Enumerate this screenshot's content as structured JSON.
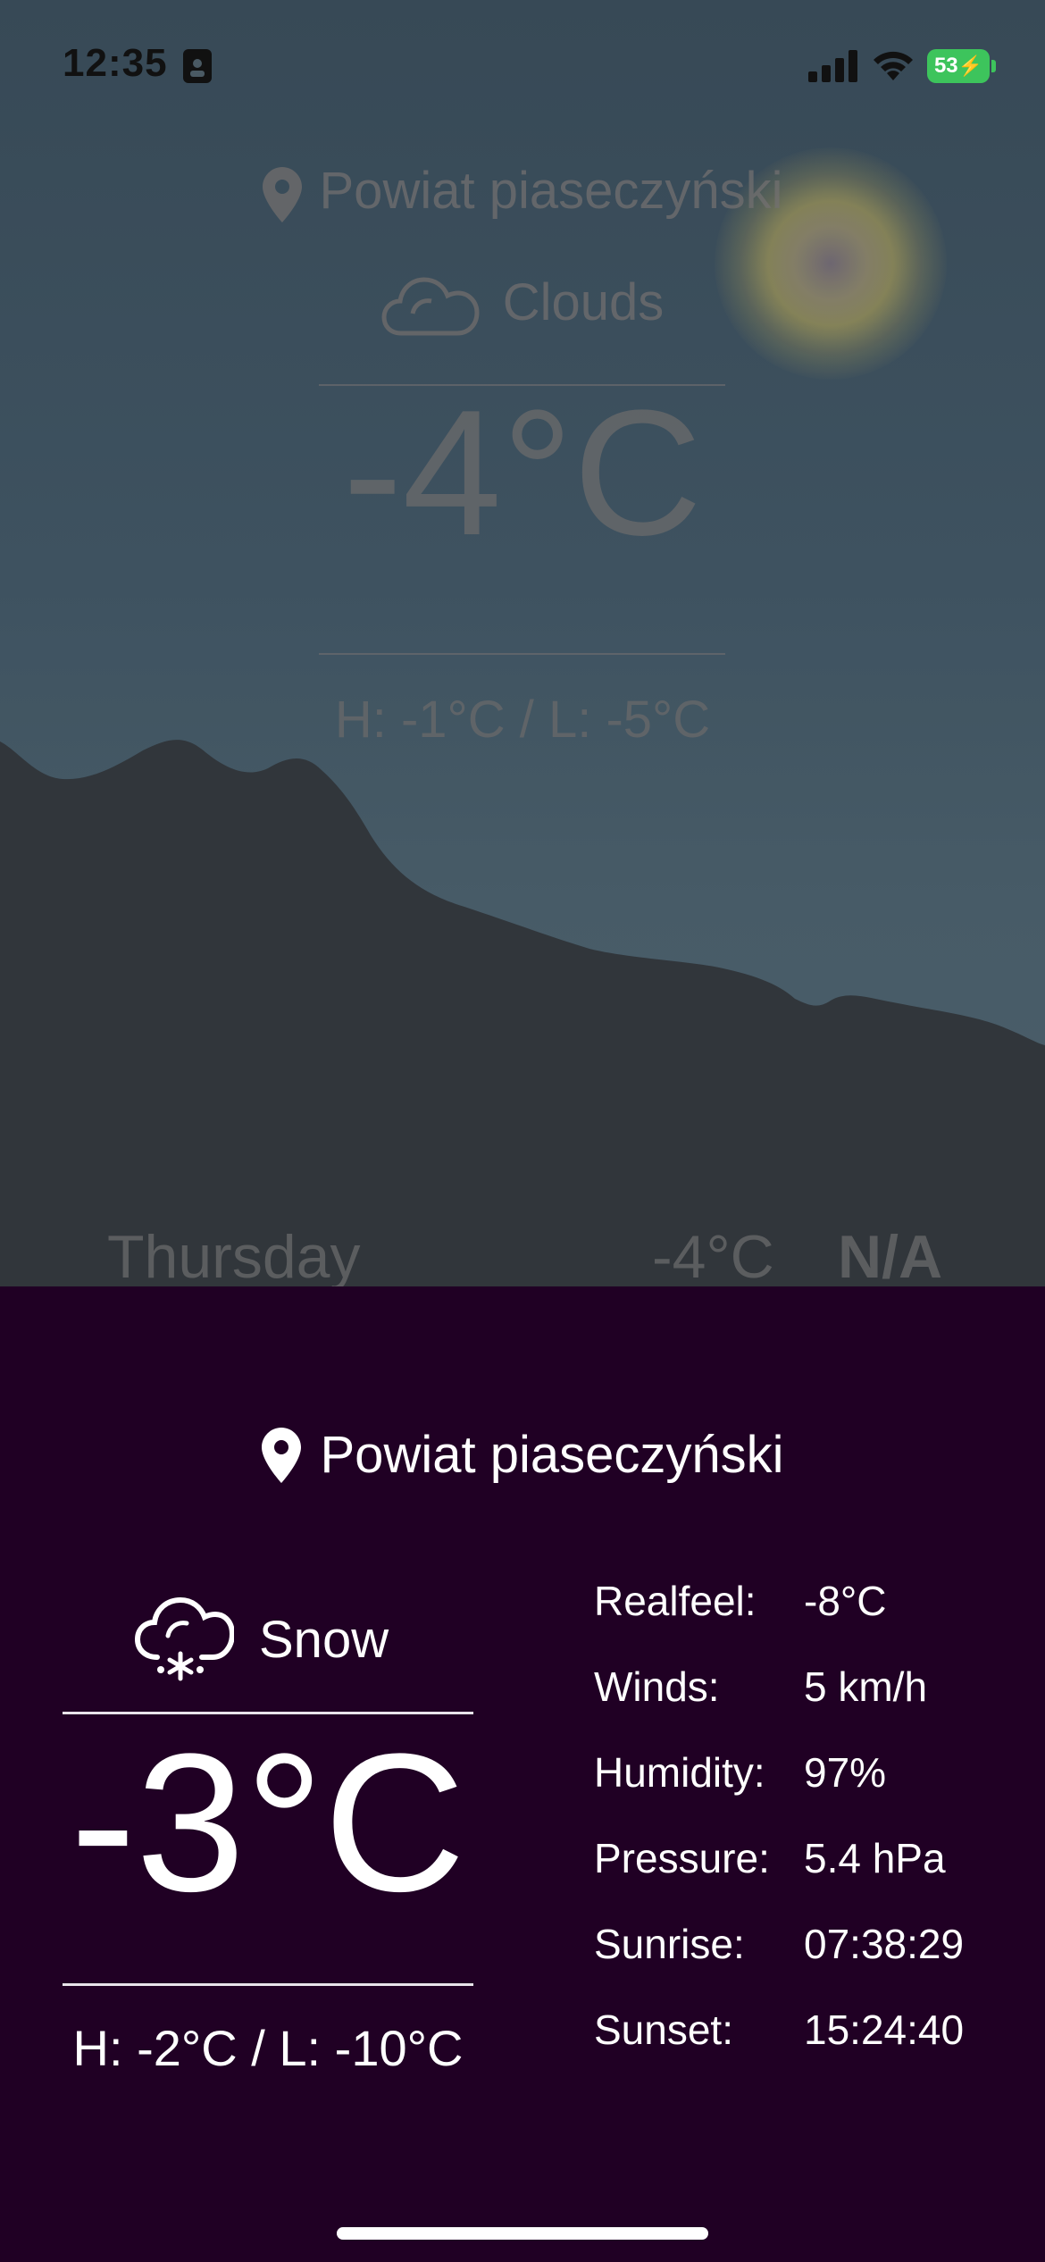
{
  "status_bar": {
    "time": "12:35",
    "battery": "53"
  },
  "background": {
    "location": "Powiat piaseczyński",
    "condition": "Clouds",
    "temperature": "-4°C",
    "high_low": "H: -1°C / L: -5°C",
    "forecast_row": {
      "day": "Thursday",
      "temp": "-4°C",
      "value": "N/A"
    }
  },
  "sheet": {
    "location": "Powiat piaseczyński",
    "condition": "Snow",
    "temperature": "-3°C",
    "high_low": "H: -2°C / L: -10°C",
    "details": [
      {
        "label": "Realfeel:",
        "value": "-8°C"
      },
      {
        "label": "Winds:",
        "value": "5 km/h"
      },
      {
        "label": "Humidity:",
        "value": "97%"
      },
      {
        "label": "Pressure:",
        "value": "5.4 hPa"
      },
      {
        "label": "Sunrise:",
        "value": "07:38:29"
      },
      {
        "label": "Sunset:",
        "value": "15:24:40"
      }
    ]
  },
  "colors": {
    "sheet_bg": "#200024",
    "sky": "#415664",
    "mountains": "#33393e",
    "battery": "#3dc45c"
  },
  "icons": [
    "sim-icon",
    "signal-icon",
    "wifi-icon",
    "location-pin-icon",
    "cloud-icon",
    "snow-cloud-icon"
  ]
}
